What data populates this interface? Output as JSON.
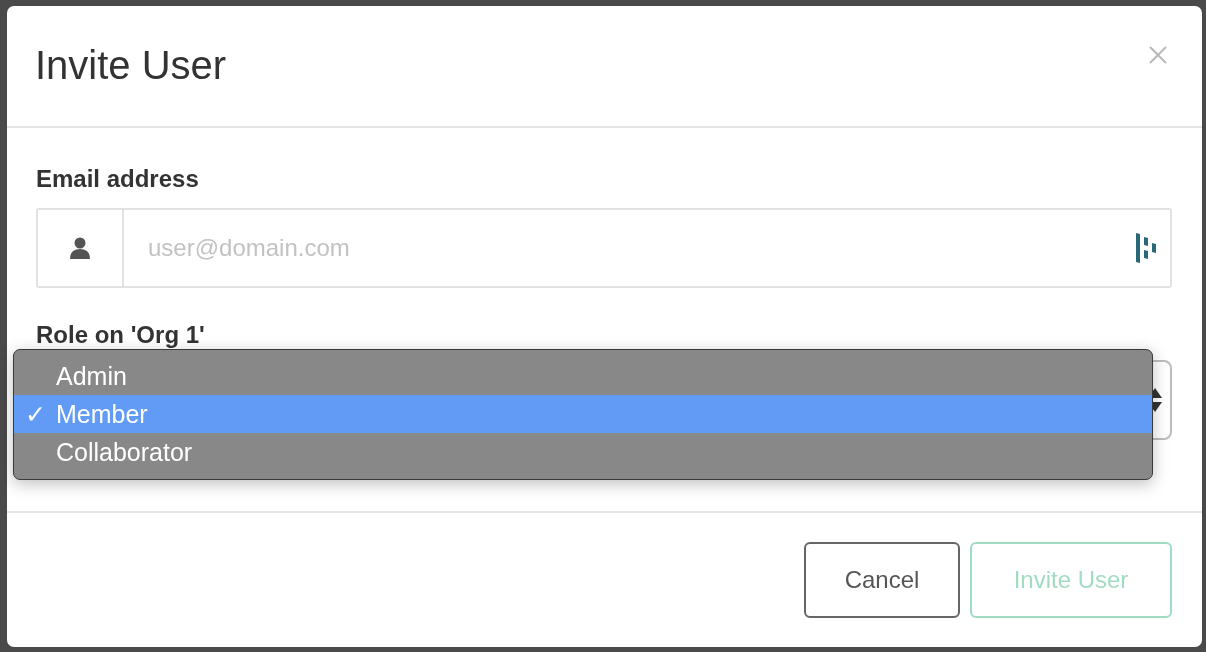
{
  "dialog": {
    "title": "Invite User"
  },
  "email": {
    "label": "Email address",
    "placeholder": "user@domain.com"
  },
  "role": {
    "label": "Role on 'Org 1'",
    "check": "✓",
    "options": [
      {
        "label": "Admin",
        "selected": false
      },
      {
        "label": "Member",
        "selected": true
      },
      {
        "label": "Collaborator",
        "selected": false
      }
    ]
  },
  "buttons": [
    {
      "label": "Cancel",
      "kind": "secondary",
      "disabled": false
    },
    {
      "label": "Invite User",
      "kind": "primary",
      "disabled": true
    }
  ]
}
